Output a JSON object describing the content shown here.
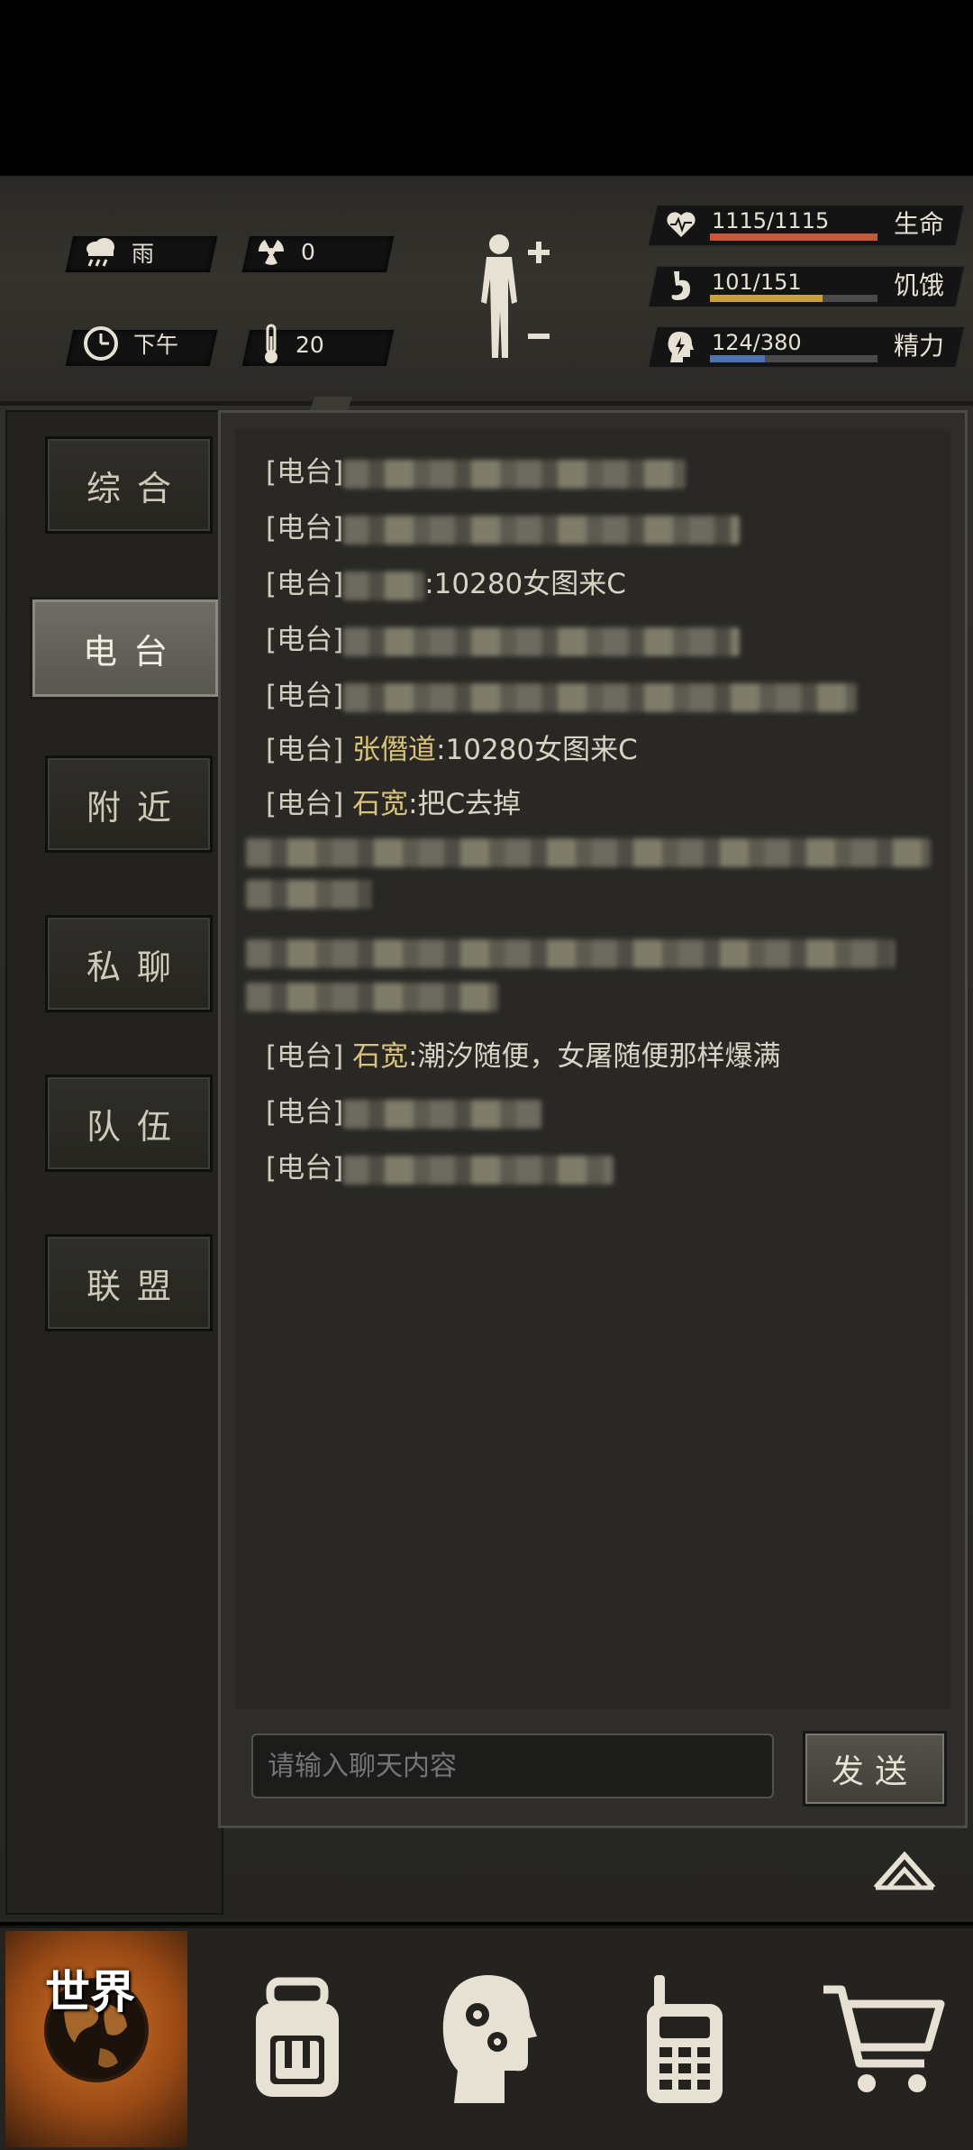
{
  "status": {
    "weather": "雨",
    "radiation": "0",
    "time_of_day": "下午",
    "temperature": "20"
  },
  "vitals": {
    "health": {
      "text": "1115/1115",
      "label": "生命",
      "fraction": 1.0,
      "color": "#c9553d"
    },
    "hunger": {
      "text": "101/151",
      "label": "饥饿",
      "fraction": 0.67,
      "color": "#c9a13b"
    },
    "energy": {
      "text": "124/380",
      "label": "精力",
      "fraction": 0.33,
      "color": "#4f73b0"
    }
  },
  "tabs": [
    {
      "label": "综合"
    },
    {
      "label": "电台"
    },
    {
      "label": "附近"
    },
    {
      "label": "私聊"
    },
    {
      "label": "队伍"
    },
    {
      "label": "联盟"
    }
  ],
  "chat": {
    "messages": [
      {
        "tag": "[电台]",
        "name": "",
        "text": ""
      },
      {
        "tag": "[电台]",
        "name": "",
        "text": ""
      },
      {
        "tag": "[电台]",
        "name": "",
        "text": ":10280女图来C"
      },
      {
        "tag": "[电台]",
        "name": "",
        "text": ""
      },
      {
        "tag": "[电台]",
        "name": "",
        "text": ""
      },
      {
        "tag": "[电台]",
        "name": "张僭道",
        "text": ":10280女图来C"
      },
      {
        "tag": "[电台]",
        "name": "石宽",
        "text": ":把C去掉"
      },
      {
        "tag": "",
        "name": "",
        "text": ""
      },
      {
        "tag": "",
        "name": "",
        "text": ""
      },
      {
        "tag": "[电台]",
        "name": "石宽",
        "text": ":潮汐随便，女屠随便那样爆满"
      },
      {
        "tag": "[电台]",
        "name": "",
        "text": ""
      },
      {
        "tag": "[电台]",
        "name": "",
        "text": ""
      }
    ],
    "input_placeholder": "请输入聊天内容",
    "send_label": "发送"
  },
  "nav": {
    "world_label": "世界",
    "items": [
      "world-icon",
      "backpack-icon",
      "skills-head-icon",
      "radio-icon",
      "cart-icon"
    ]
  }
}
